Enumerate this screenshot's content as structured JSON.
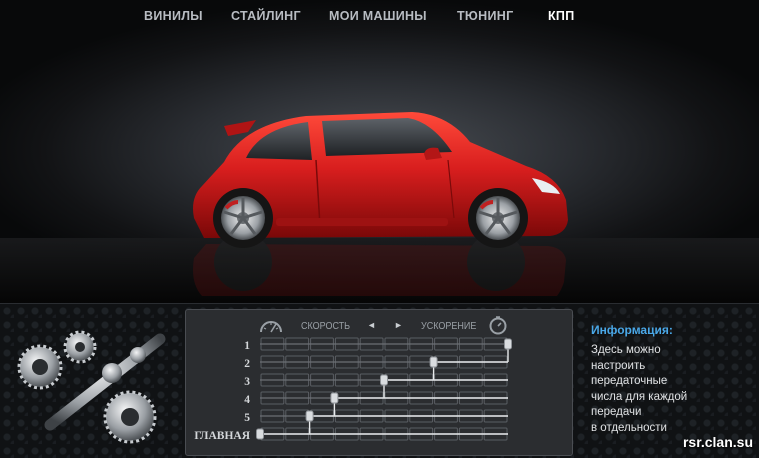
{
  "menu": {
    "items": [
      {
        "label": "ВИНИЛЫ",
        "active": false
      },
      {
        "label": "СТАЙЛИНГ",
        "active": false
      },
      {
        "label": "МОИ МАШИНЫ",
        "active": false
      },
      {
        "label": "ТЮНИНГ",
        "active": false
      },
      {
        "label": "КПП",
        "active": true
      }
    ]
  },
  "car": {
    "color": "#d81e1e",
    "icon": "hatchback-car"
  },
  "gearbox": {
    "speed_label": "СКОРОСТЬ",
    "accel_label": "УСКОРЕНИЕ",
    "left_arrow": "◄",
    "right_arrow": "►",
    "gears": [
      {
        "label": "1",
        "level": 1.0
      },
      {
        "label": "2",
        "level": 0.7
      },
      {
        "label": "3",
        "level": 0.5
      },
      {
        "label": "4",
        "level": 0.3
      },
      {
        "label": "5",
        "level": 0.2
      },
      {
        "label": "ГЛАВНАЯ",
        "level": 0.0
      }
    ]
  },
  "info": {
    "title": "Информация:",
    "lines": [
      "Здесь можно",
      "настроить",
      "передаточные",
      "числа для каждой",
      "передачи",
      "в отдельности"
    ]
  },
  "watermark": "rsr.clan.su",
  "colors": {
    "accent": "#4aa8e8",
    "active_menu": "#ffffff",
    "menu": "#b8bcc2"
  }
}
